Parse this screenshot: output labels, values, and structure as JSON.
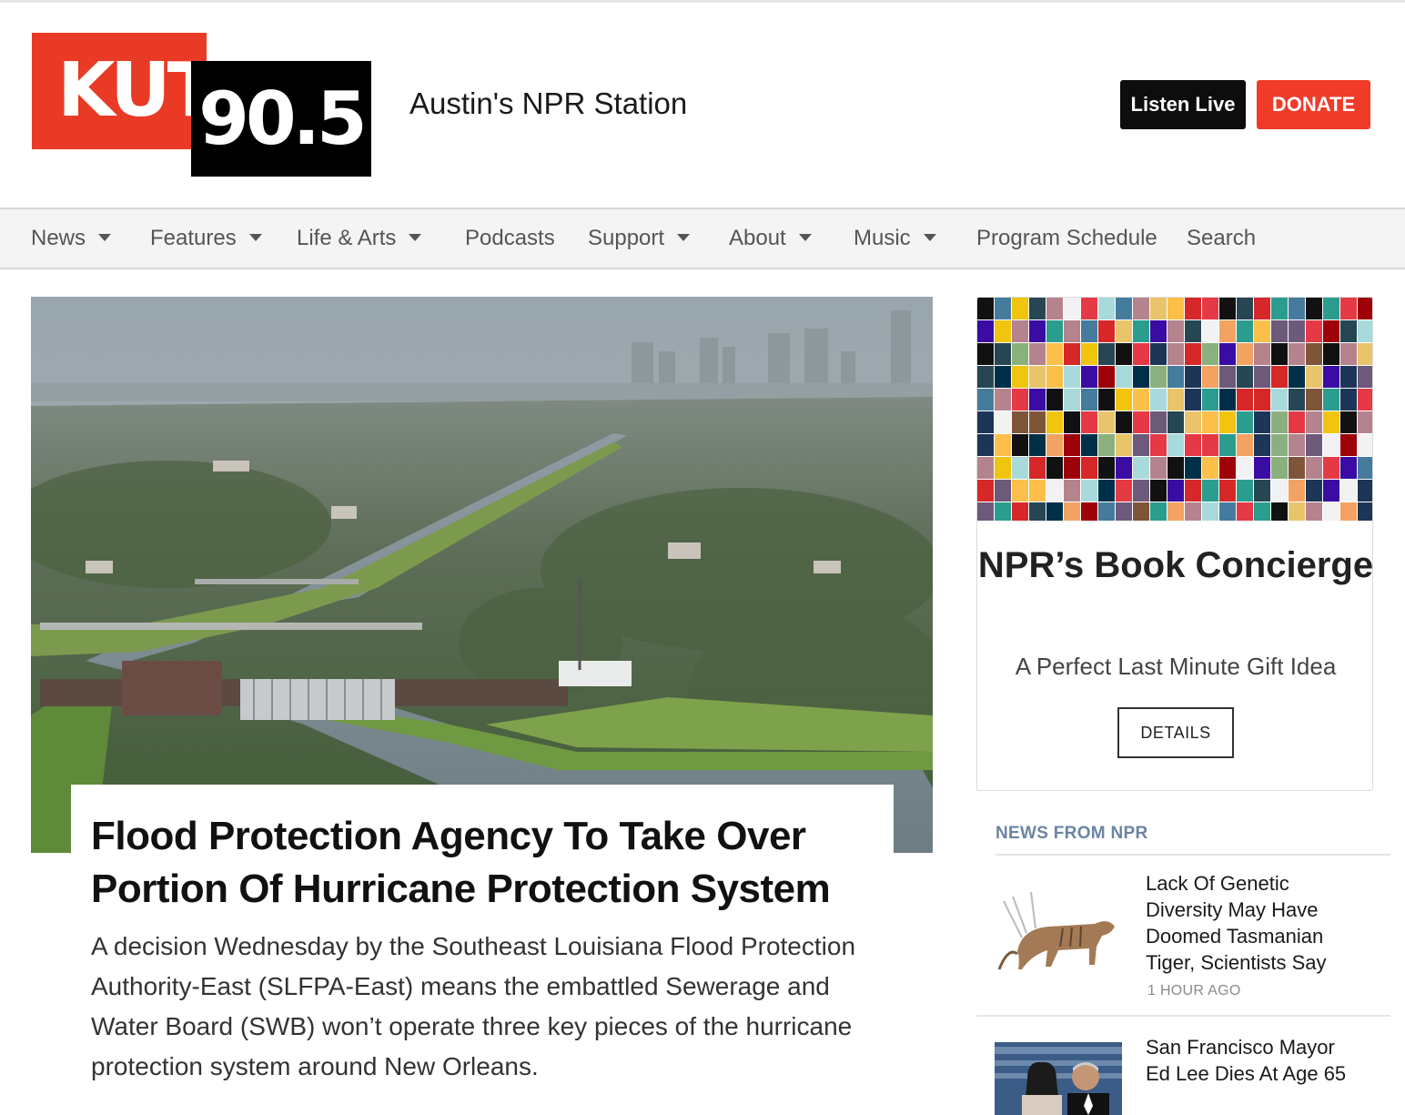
{
  "header": {
    "logo_primary": "KUT",
    "logo_secondary": "90.5",
    "tagline": "Austin's NPR Station",
    "listen_label": "Listen Live",
    "donate_label": "DONATE"
  },
  "nav": {
    "items": [
      {
        "label": "News",
        "dropdown": true
      },
      {
        "label": "Features",
        "dropdown": true
      },
      {
        "label": "Life & Arts",
        "dropdown": true
      },
      {
        "label": "Podcasts",
        "dropdown": false
      },
      {
        "label": "Support",
        "dropdown": true
      },
      {
        "label": "About",
        "dropdown": true
      },
      {
        "label": "Music",
        "dropdown": true
      },
      {
        "label": "Program Schedule",
        "dropdown": false
      },
      {
        "label": "Search",
        "dropdown": false
      }
    ]
  },
  "hero": {
    "title": "Flood Protection Agency To Take Over Portion Of Hurricane Protection System",
    "summary": "A decision Wednesday by the Southeast Louisiana Flood Protection Authority-East (SLFPA-East) means the embattled Sewerage and Water Board (SWB) won’t operate three key pieces of the hurricane protection system around New Orleans."
  },
  "promo": {
    "title": "NPR’s Book Concierge",
    "subtitle": "A Perfect Last Minute Gift Idea",
    "button_label": "DETAILS"
  },
  "news_from_npr": {
    "heading": "NEWS FROM NPR",
    "stories": [
      {
        "title": "Lack Of Genetic Diversity May Have Doomed Tasmanian Tiger, Scientists Say",
        "time": "1 HOUR AGO"
      },
      {
        "title": "San Francisco Mayor Ed Lee Dies At Age 65",
        "time": ""
      }
    ]
  },
  "colors": {
    "brand_red": "#e93a25",
    "donate_red": "#ef3b28",
    "npr_heading_blue": "#6c84a3"
  }
}
